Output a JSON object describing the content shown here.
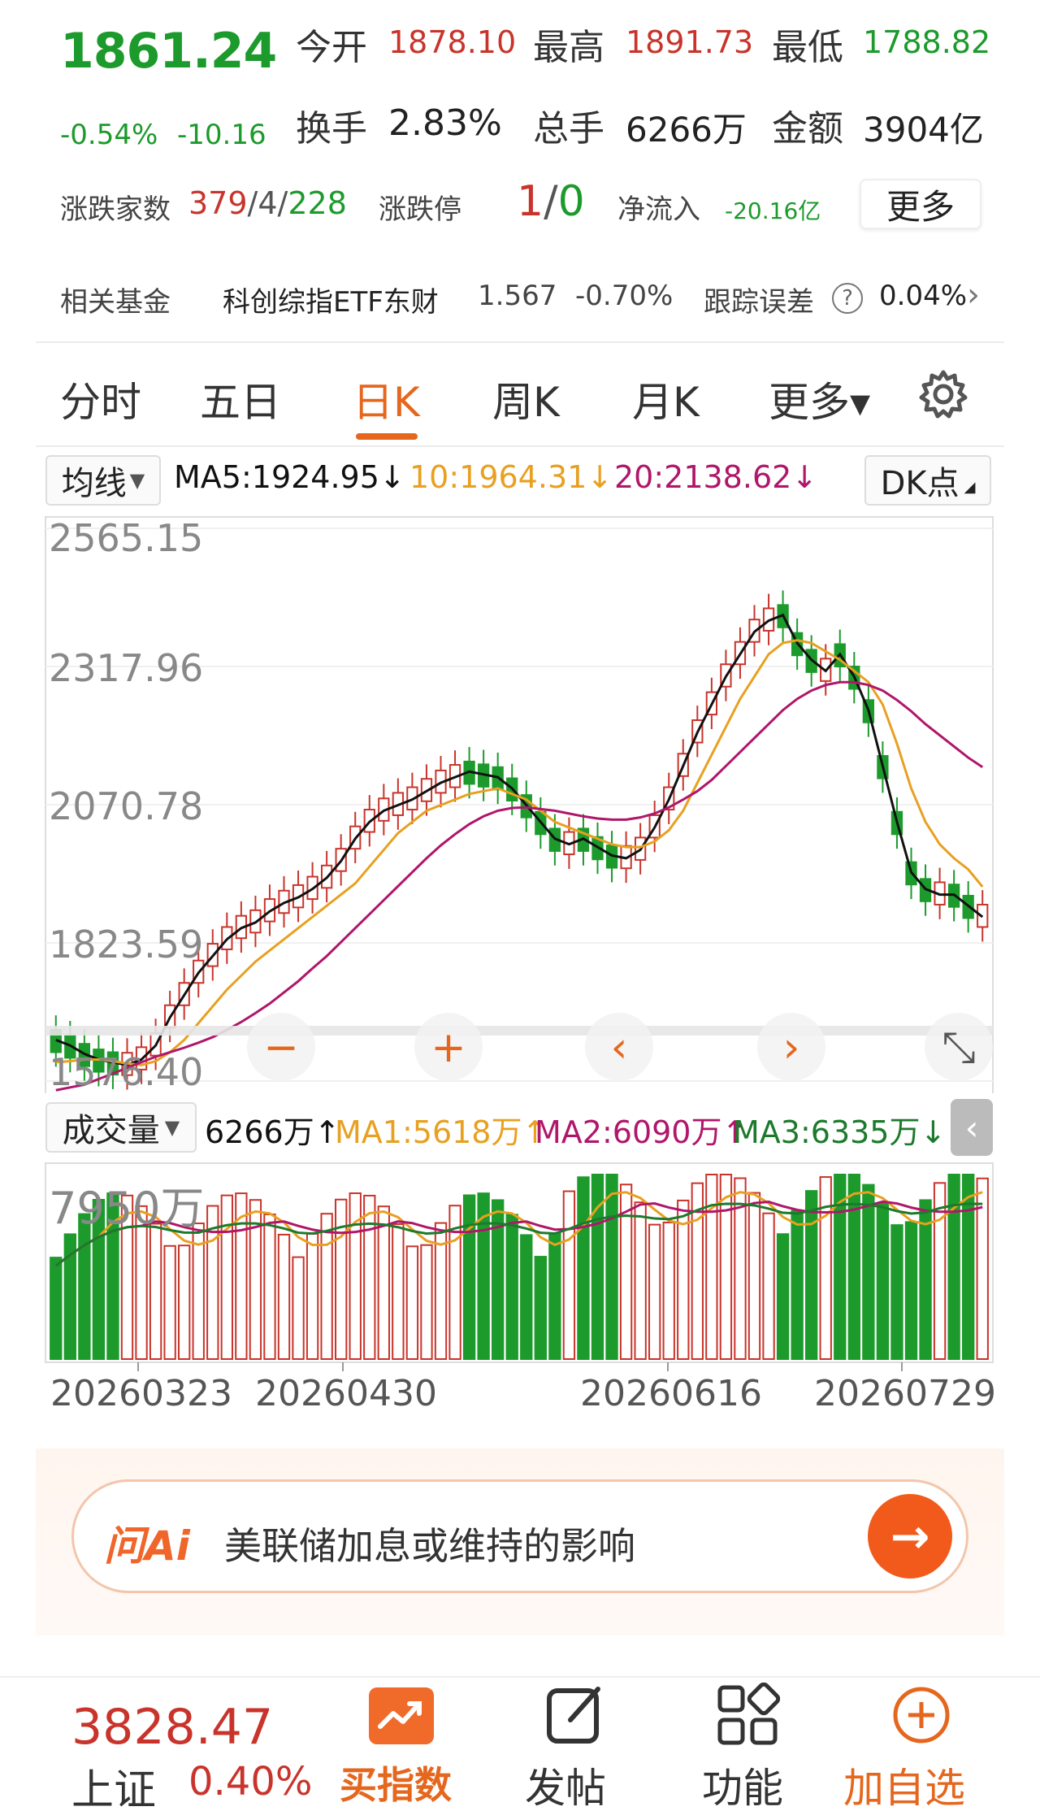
{
  "quote": {
    "price": "1861.24",
    "change_pct": "-0.54%",
    "change": "-10.16",
    "open_label": "今开",
    "open": "1878.10",
    "high_label": "最高",
    "high": "1891.73",
    "low_label": "最低",
    "low": "1788.82",
    "turnover_label": "换手",
    "turnover": "2.83%",
    "volume_label": "总手",
    "volume": "6266万",
    "amount_label": "金额",
    "amount": "3904亿",
    "breadth_label": "涨跌家数",
    "breadth_up": "379",
    "breadth_sep1": "/",
    "breadth_flat": "4",
    "breadth_sep2": "/",
    "breadth_down": "228",
    "limit_label": "涨跌停",
    "limit_up": "1",
    "limit_sep": "/",
    "limit_down": "0",
    "netflow_label": "净流入",
    "netflow": "-20.16亿",
    "more_label": "更多"
  },
  "fund": {
    "label": "相关基金",
    "name": "科创综指ETF东财",
    "price": "1.567",
    "change": "-0.70%",
    "track_label": "跟踪误差",
    "track_value": "0.04%",
    "help": "?",
    "arrow": "›"
  },
  "tabs": [
    {
      "label": "分时"
    },
    {
      "label": "五日"
    },
    {
      "label": "日K"
    },
    {
      "label": "周K"
    },
    {
      "label": "月K"
    },
    {
      "label": "更多▾"
    }
  ],
  "ma": {
    "selector": "均线",
    "ma5": "MA5:1924.95↓",
    "ma10": "10:1964.31↓",
    "ma20": "20:2138.62↓",
    "dk": "DK点"
  },
  "volume": {
    "selector": "成交量",
    "total": "6266万↑",
    "ma1": "MA1:5618万↑",
    "ma2": "MA2:6090万↑",
    "ma3": "MA3:6335万↓",
    "axis_max": "7950万"
  },
  "colors": {
    "up": "#c8342b",
    "down": "#1c9a2c",
    "ma5": "#111111",
    "ma10": "#e8a020",
    "ma20": "#b0166a",
    "accent": "#e5671e"
  },
  "chart_data": {
    "type": "candlestick",
    "y_ticks": [
      "2565.15",
      "2317.96",
      "2070.78",
      "1823.59",
      "1576.40"
    ],
    "ylim": [
      1576.4,
      2565.15
    ],
    "x_ticks": [
      "20260323",
      "20260430",
      "20260616",
      "20260729"
    ],
    "controls": [
      "−",
      "+",
      "‹",
      "›",
      "⤡"
    ],
    "series": [
      {
        "name": "MA5",
        "values": [
          1650,
          1640,
          1625,
          1615,
          1610,
          1605,
          1615,
          1640,
          1690,
          1730,
          1770,
          1800,
          1830,
          1850,
          1860,
          1880,
          1895,
          1905,
          1920,
          1940,
          1970,
          2010,
          2040,
          2060,
          2070,
          2080,
          2095,
          2110,
          2120,
          2130,
          2125,
          2120,
          2100,
          2070,
          2040,
          2010,
          2000,
          2010,
          1995,
          1980,
          1975,
          1990,
          2030,
          2080,
          2140,
          2200,
          2250,
          2300,
          2340,
          2380,
          2400,
          2410,
          2360,
          2330,
          2310,
          2340,
          2300,
          2240,
          2140,
          2040,
          1950,
          1920,
          1910,
          1910,
          1890,
          1870
        ]
      },
      {
        "name": "MA10",
        "values": [
          1610,
          1612,
          1615,
          1615,
          1612,
          1608,
          1605,
          1612,
          1628,
          1650,
          1680,
          1710,
          1740,
          1765,
          1790,
          1810,
          1830,
          1850,
          1870,
          1890,
          1910,
          1930,
          1960,
          1990,
          2020,
          2040,
          2060,
          2070,
          2080,
          2090,
          2095,
          2100,
          2090,
          2080,
          2060,
          2040,
          2030,
          2020,
          2010,
          2000,
          1995,
          1995,
          2005,
          2025,
          2060,
          2110,
          2160,
          2210,
          2260,
          2300,
          2340,
          2360,
          2365,
          2360,
          2345,
          2330,
          2310,
          2290,
          2250,
          2180,
          2100,
          2040,
          2000,
          1975,
          1955,
          1924
        ]
      },
      {
        "name": "MA20",
        "values": [
          1560,
          1565,
          1570,
          1580,
          1590,
          1600,
          1610,
          1620,
          1628,
          1636,
          1645,
          1655,
          1668,
          1682,
          1698,
          1715,
          1735,
          1755,
          1778,
          1800,
          1825,
          1850,
          1875,
          1900,
          1925,
          1950,
          1975,
          1998,
          2018,
          2036,
          2050,
          2060,
          2065,
          2066,
          2063,
          2060,
          2055,
          2050,
          2046,
          2044,
          2044,
          2048,
          2055,
          2066,
          2080,
          2095,
          2115,
          2140,
          2165,
          2190,
          2215,
          2240,
          2260,
          2275,
          2285,
          2290,
          2290,
          2285,
          2275,
          2258,
          2238,
          2215,
          2195,
          2175,
          2155,
          2138
        ]
      }
    ],
    "volume_ylim": [
      0,
      7950
    ]
  },
  "ai": {
    "logo": "问Ai",
    "prompt": "美联储加息或维持的影响",
    "go": "→"
  },
  "bottom": {
    "index_value": "3828.47",
    "index_name": "上证",
    "index_change": "0.40%",
    "items": [
      {
        "label": "买指数"
      },
      {
        "label": "发帖"
      },
      {
        "label": "功能"
      },
      {
        "label": "加自选"
      }
    ]
  }
}
